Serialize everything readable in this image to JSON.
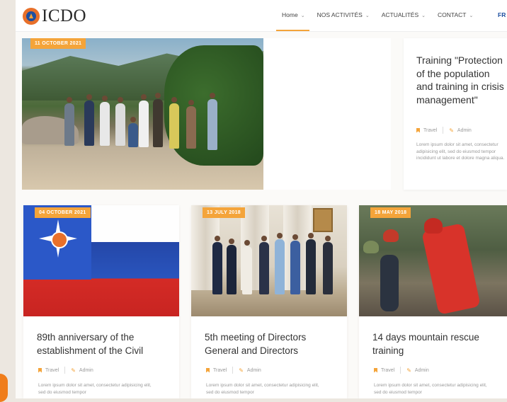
{
  "header": {
    "logo_text": "ICDO",
    "nav": [
      {
        "label": "Home",
        "chevron": "⌄",
        "active": true
      },
      {
        "label": "NOS ACTIVITÉS",
        "chevron": "⌄"
      },
      {
        "label": "ACTUALITÉS",
        "chevron": "⌄"
      },
      {
        "label": "CONTACT",
        "chevron": "⌄"
      }
    ],
    "language": "FR"
  },
  "featured": {
    "date": "11 OCTOBER 2021",
    "title": "Training \"Protection of the population and training in crisis management\"",
    "category": "Travel",
    "author": "Admin",
    "excerpt": "Lorem ipsum dolor sit amet, consectetur adipisicing elit, sed do eiusmod tempor incididunt ut labore et dolore magna aliqua."
  },
  "cards": [
    {
      "date": "04 OCTOBER 2021",
      "title": "89th anniversary of the establishment of the Civil",
      "category": "Travel",
      "author": "Admin",
      "excerpt": "Lorem ipsum dolor sit amet, consectetur adipisicing elit, sed do eiusmod tempor"
    },
    {
      "date": "13 JULY 2018",
      "title": "5th meeting of Directors General and Directors",
      "category": "Travel",
      "author": "Admin",
      "excerpt": "Lorem ipsum dolor sit amet, consectetur adipisicing elit, sed do eiusmod tempor"
    },
    {
      "date": "18 MAY 2018",
      "title": "14 days mountain rescue training",
      "category": "Travel",
      "author": "Admin",
      "excerpt": "Lorem ipsum dolor sit amet, consectetur adipisicing elit, sed do eiusmod tempor"
    }
  ],
  "colors": {
    "accent": "#f4a43a",
    "brand_blue": "#1d4fa0",
    "brand_orange": "#e8702a"
  },
  "icons": {
    "category": "bookmark-icon",
    "author": "pencil-icon",
    "nav_chevron": "chevron-down-icon"
  }
}
